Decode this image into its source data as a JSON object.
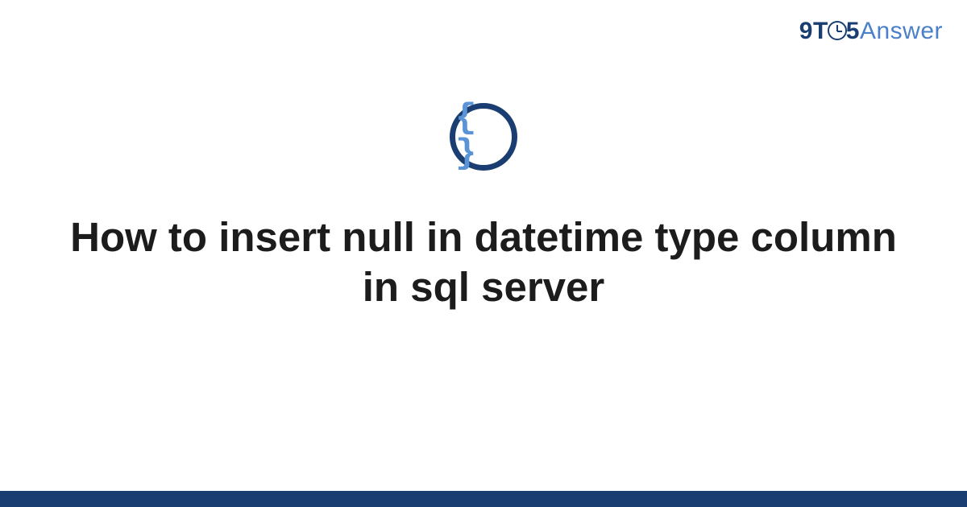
{
  "brand": {
    "nine": "9",
    "t": "T",
    "five": "5",
    "answer": "Answer"
  },
  "icon": {
    "name": "code-braces-icon",
    "glyph": "{ }"
  },
  "heading": "How to insert null in datetime type column in sql server",
  "colors": {
    "primary": "#1a3e72",
    "accent": "#4a7fc9",
    "brace": "#5a93d6"
  }
}
